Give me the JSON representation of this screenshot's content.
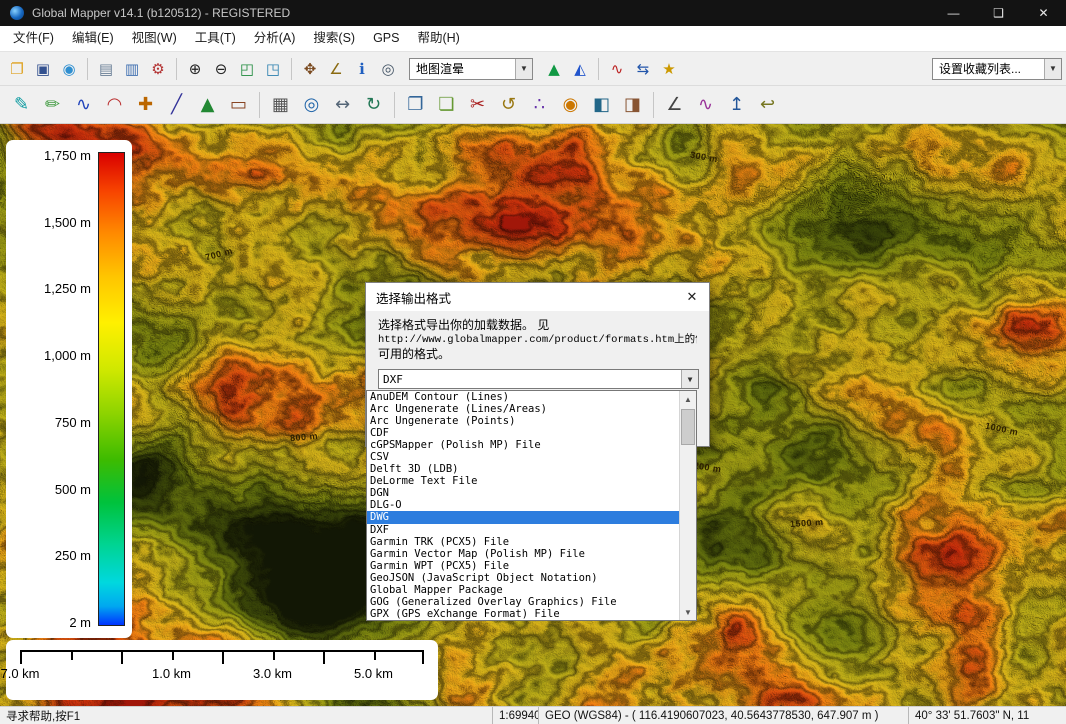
{
  "colors": {
    "selection": "#2d7dde",
    "titlebar_bg": "#131313",
    "toolbar_bg": "#f0f0f0"
  },
  "icons": {
    "dropdown": "▼",
    "scroll_up": "▲",
    "scroll_down": "▼"
  },
  "window": {
    "title": "Global Mapper v14.1 (b120512) - REGISTERED",
    "controls": {
      "minimize": "—",
      "maximize": "❑",
      "close": "✕"
    }
  },
  "menu": {
    "items": [
      "文件(F)",
      "编辑(E)",
      "视图(W)",
      "工具(T)",
      "分析(A)",
      "搜索(S)",
      "GPS",
      "帮助(H)"
    ]
  },
  "toolbar1": {
    "group1": [
      {
        "name": "open-data-icon",
        "glyph": "❐",
        "color": "#dfa322"
      },
      {
        "name": "save-workspace-icon",
        "glyph": "▣",
        "color": "#33518f"
      },
      {
        "name": "download-online-data-icon",
        "glyph": "◉",
        "color": "#2f8fd0"
      }
    ],
    "group2": [
      {
        "name": "overlay-control-center-icon",
        "glyph": "▤",
        "color": "#6a7f96"
      },
      {
        "name": "map-catalog-icon",
        "glyph": "▥",
        "color": "#3f6fb0"
      },
      {
        "name": "configuration-icon",
        "glyph": "⚙",
        "color": "#b33333"
      }
    ],
    "group3": [
      {
        "name": "zoom-in-icon",
        "glyph": "⊕",
        "color": "#222222"
      },
      {
        "name": "zoom-out-icon",
        "glyph": "⊖",
        "color": "#222222"
      },
      {
        "name": "full-view-icon",
        "glyph": "◰",
        "color": "#1e8a3c"
      },
      {
        "name": "zoom-window-icon",
        "glyph": "◳",
        "color": "#2b7fae"
      }
    ],
    "group4": [
      {
        "name": "pan-hand-icon",
        "glyph": "✥",
        "color": "#7a4a20"
      },
      {
        "name": "measure-tool-icon",
        "glyph": "∠",
        "color": "#8a6a10"
      },
      {
        "name": "feature-info-icon",
        "glyph": "ℹ",
        "color": "#1f5fc0"
      },
      {
        "name": "search-binoculars-icon",
        "glyph": "◎",
        "color": "#445566"
      }
    ],
    "map_type_combo": "地图渲晕",
    "group5": [
      {
        "name": "terrain-shader-icon",
        "glyph": "▲",
        "color": "#119944"
      },
      {
        "name": "view-3d-icon",
        "glyph": "◭",
        "color": "#2255cc"
      }
    ],
    "group6": [
      {
        "name": "path-profile-icon",
        "glyph": "∿",
        "color": "#bb2222"
      },
      {
        "name": "image-swipe-icon",
        "glyph": "⇆",
        "color": "#2255aa"
      },
      {
        "name": "favorite-views-icon",
        "glyph": "★",
        "color": "#cc9900"
      }
    ],
    "favorites_combo": "设置收藏列表..."
  },
  "toolbar2": {
    "group1": [
      {
        "name": "digitizer-tool-icon",
        "glyph": "✎",
        "color": "#0a9aa0"
      },
      {
        "name": "edit-feature-icon",
        "glyph": "✏",
        "color": "#3f9a3f"
      },
      {
        "name": "create-spline-icon",
        "glyph": "∿",
        "color": "#2244bb"
      },
      {
        "name": "create-arc-icon",
        "glyph": "◠",
        "color": "#bb3333"
      },
      {
        "name": "create-point-icon",
        "glyph": "✚",
        "color": "#bb6600"
      },
      {
        "name": "create-line-icon",
        "glyph": "╱",
        "color": "#333399"
      },
      {
        "name": "create-area-icon",
        "glyph": "▲",
        "color": "#228833"
      },
      {
        "name": "create-rectangle-icon",
        "glyph": "▭",
        "color": "#884422"
      }
    ],
    "group2": [
      {
        "name": "create-grid-icon",
        "glyph": "▦",
        "color": "#555555"
      },
      {
        "name": "create-range-rings-icon",
        "glyph": "◎",
        "color": "#2266aa"
      },
      {
        "name": "move-feature-icon",
        "glyph": "↔",
        "color": "#556677"
      },
      {
        "name": "rotate-feature-icon",
        "glyph": "↻",
        "color": "#227755"
      }
    ],
    "group3": [
      {
        "name": "copy-feature-icon",
        "glyph": "❐",
        "color": "#336699"
      },
      {
        "name": "paste-feature-icon",
        "glyph": "❏",
        "color": "#669933"
      },
      {
        "name": "delete-feature-icon",
        "glyph": "✂",
        "color": "#aa2222"
      },
      {
        "name": "undo-edit-icon",
        "glyph": "↺",
        "color": "#997711"
      },
      {
        "name": "vertex-edit-icon",
        "glyph": "∴",
        "color": "#6633aa"
      },
      {
        "name": "snap-toggle-icon",
        "glyph": "◉",
        "color": "#cc7700"
      },
      {
        "name": "combine-areas-icon",
        "glyph": "◧",
        "color": "#226688"
      },
      {
        "name": "split-features-icon",
        "glyph": "◨",
        "color": "#885533"
      }
    ],
    "group4": [
      {
        "name": "measure-digitizer-icon",
        "glyph": "∠",
        "color": "#444444"
      },
      {
        "name": "profile-digitizer-icon",
        "glyph": "∿",
        "color": "#993399"
      },
      {
        "name": "export-selected-icon",
        "glyph": "↥",
        "color": "#225599"
      },
      {
        "name": "revert-edits-icon",
        "glyph": "↩",
        "color": "#777722"
      }
    ]
  },
  "legend": {
    "labels": [
      "1,750 m",
      "1,500 m",
      "1,250 m",
      "1,000 m",
      "750 m",
      "500 m",
      "250 m",
      "2 m"
    ]
  },
  "scalebar": {
    "labels": [
      "1.0 km",
      "3.0 km",
      "5.0 km",
      "7.0 km"
    ]
  },
  "map": {
    "contour_labels": [
      "700 m",
      "300 m",
      "800 m",
      "1200 m",
      "1500 m",
      "1000 m"
    ]
  },
  "dialog": {
    "title": "选择输出格式",
    "close": "✕",
    "body_line1": "选择格式导出你的加载数据。 见",
    "body_line2": "http://www.globalmapper.com/product/formats.htm上的信息",
    "body_line3": "可用的格式。",
    "combo_value": "DXF",
    "selected_format": "DWG",
    "formats": [
      "AnuDEM Contour (Lines)",
      "Arc Ungenerate (Lines/Areas)",
      "Arc Ungenerate (Points)",
      "CDF",
      "cGPSMapper (Polish MP) File",
      "CSV",
      "Delft 3D (LDB)",
      "DeLorme Text File",
      "DGN",
      "DLG-O",
      "DWG",
      "DXF",
      "Garmin TRK (PCX5) File",
      "Garmin Vector Map (Polish MP) File",
      "Garmin WPT (PCX5) File",
      "GeoJSON (JavaScript Object Notation)",
      "Global Mapper Package",
      "GOG (Generalized Overlay Graphics) File",
      "GPX (GPS eXchange Format) File"
    ]
  },
  "statusbar": {
    "help": "寻求帮助,按F1",
    "scale": "1:69940",
    "position": "GEO (WGS84) - ( 116.4190607023, 40.5643778530, 647.907 m )",
    "latlon": "40° 33' 51.7603\" N, 11"
  }
}
